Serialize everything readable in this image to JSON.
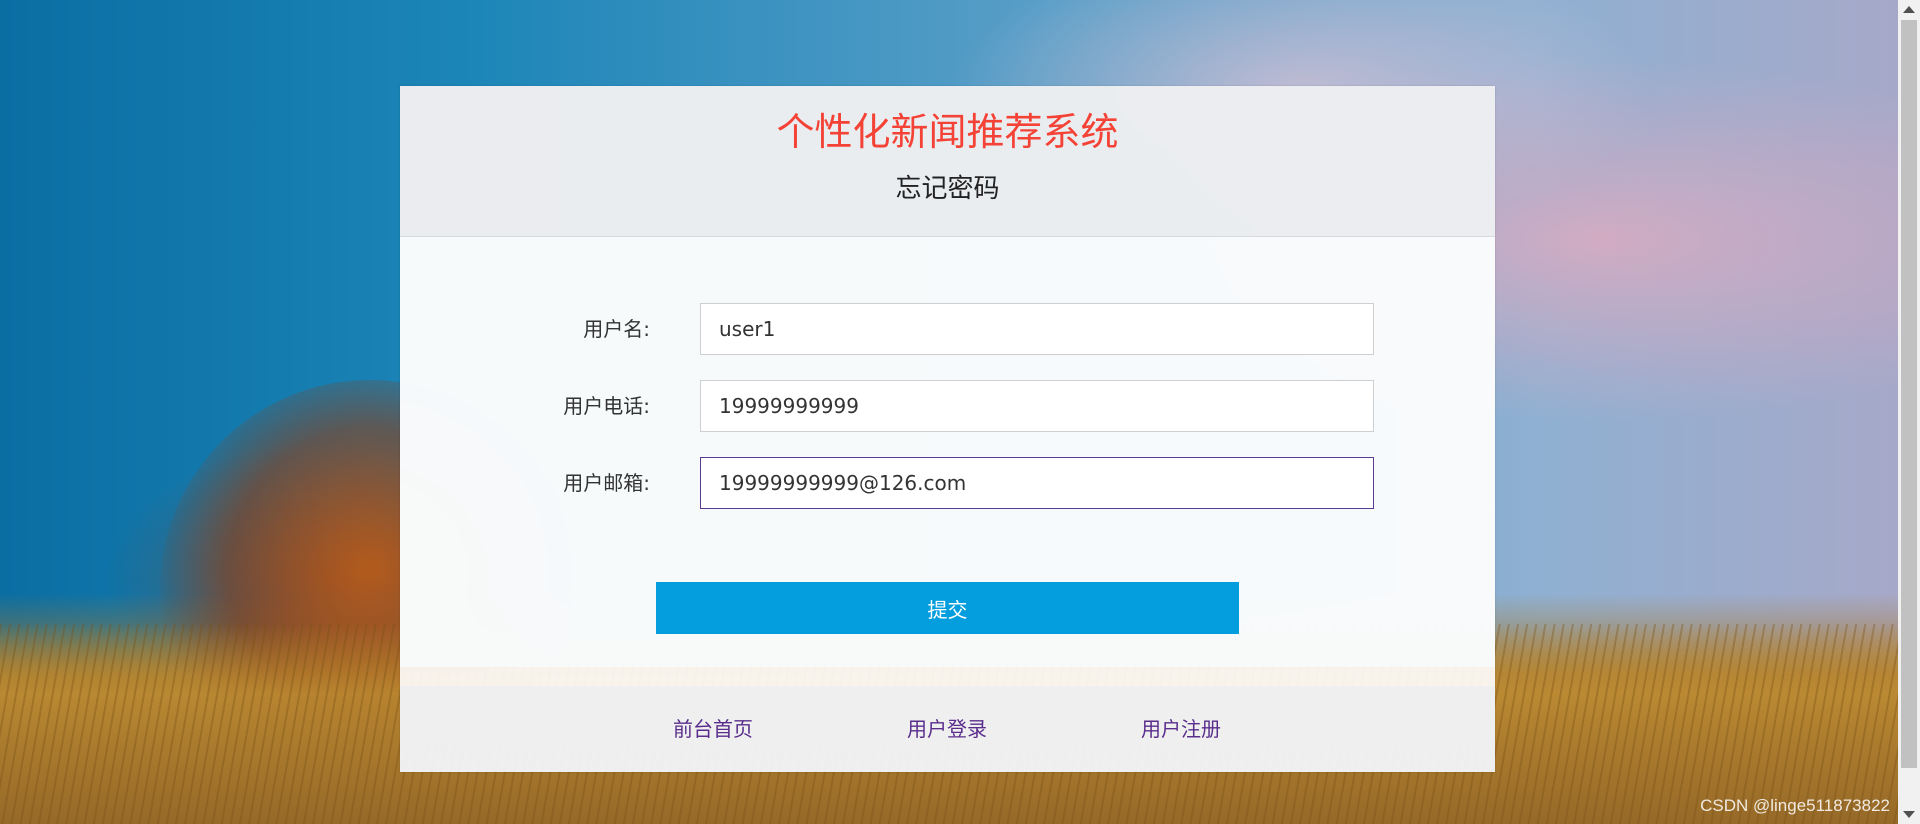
{
  "header": {
    "system_title": "个性化新闻推荐系统",
    "page_title": "忘记密码"
  },
  "form": {
    "username": {
      "label": "用户名:",
      "value": "user1"
    },
    "phone": {
      "label": "用户电话:",
      "value": "19999999999"
    },
    "email": {
      "label": "用户邮箱:",
      "value": "19999999999@126.com"
    },
    "submit_label": "提交"
  },
  "footer": {
    "links": [
      "前台首页",
      "用户登录",
      "用户注册"
    ]
  },
  "watermark": "CSDN @linge511873822",
  "colors": {
    "title": "#f44336",
    "button": "#049ede",
    "link": "#5a2d8c",
    "focus_border": "#5b3a94"
  }
}
